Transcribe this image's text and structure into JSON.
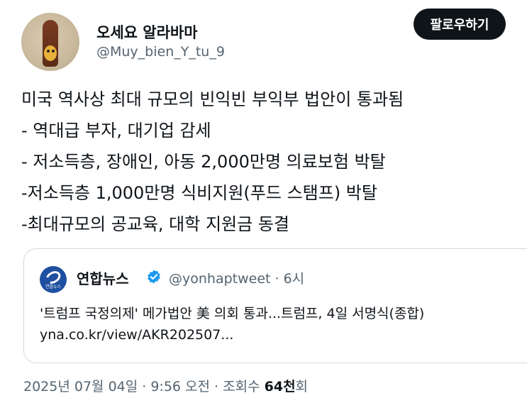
{
  "author": {
    "display_name": "오세요 알라바마",
    "handle": "@Muy_bien_Y_tu_9"
  },
  "follow_button": {
    "label": "팔로우하기"
  },
  "tweet": {
    "lines": [
      "미국 역사상 최대 규모의 빈익빈 부익부 법안이 통과됨",
      "- 역대급 부자, 대기업 감세",
      "- 저소득층, 장애인, 아동 2,000만명 의료보험 박탈",
      "-저소득층 1,000만명 식비지원(푸드 스탬프) 박탈",
      "-최대규모의 공교육, 대학 지원금 동결"
    ]
  },
  "quote": {
    "name": "연합뉴스",
    "avatar_caption": "연합뉴스",
    "handle_time": "@yonhaptweet · 6시",
    "text": "'트럼프 국정의제' 메가법안 美 의회 통과...트럼프, 4일 서명식(종합)",
    "link": "yna.co.kr/view/AKR202507..."
  },
  "meta": {
    "date_time_views_prefix": "2025년 07월 04일 · 9:56 오전 · 조회수 ",
    "views_count": "64천",
    "views_suffix": "회"
  },
  "icons": {
    "verified": "verified-badge-icon"
  },
  "colors": {
    "text_primary": "#0f1419",
    "text_secondary": "#536471",
    "verified_blue": "#1d9bf0",
    "border": "#cfd9de"
  }
}
